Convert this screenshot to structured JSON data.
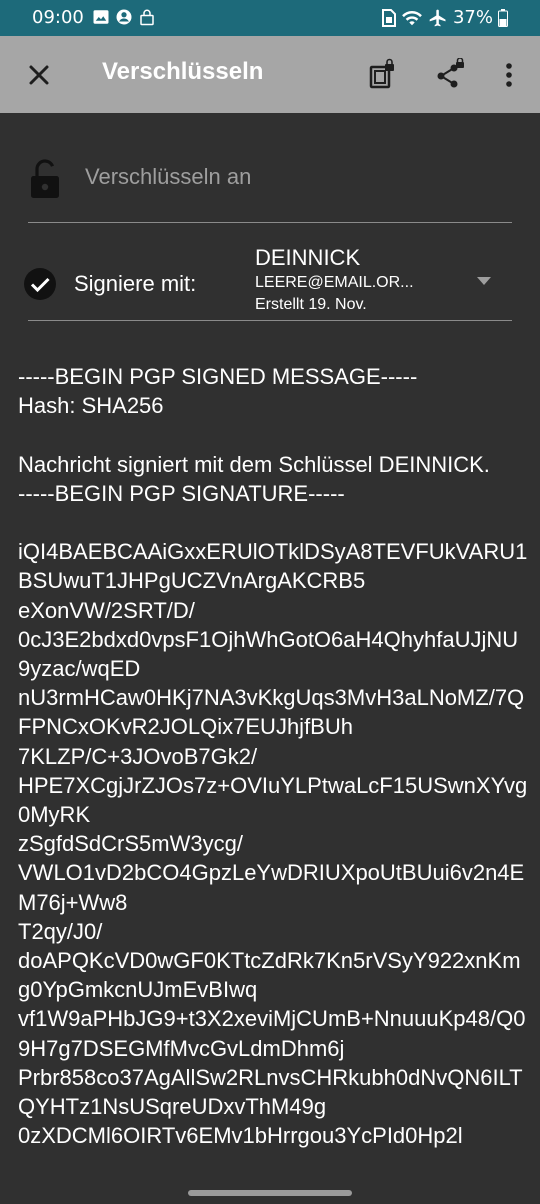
{
  "status_bar": {
    "time": "09:00",
    "battery": "37%",
    "left_icons": [
      "image-icon",
      "account-icon",
      "lock-icon"
    ],
    "right_icons": [
      "sim-icon",
      "wifi-icon",
      "airplane-icon",
      "battery-icon"
    ]
  },
  "toolbar": {
    "title": "Verschlüsseln",
    "actions": [
      "copy-to-clipboard-icon",
      "share-icon",
      "more-options-icon"
    ]
  },
  "encrypt": {
    "label": "Verschlüsseln an",
    "icon": "lock-open-icon"
  },
  "sign": {
    "label": "Signiere mit:",
    "key_name": "DEINNICK",
    "key_email": "LEERE@EMAIL.OR...",
    "key_created": "Erstellt 19. Nov.",
    "checked": true
  },
  "message": {
    "text": "-----BEGIN PGP SIGNED MESSAGE-----\nHash: SHA256\n\nNachricht signiert mit dem Schlüssel DEINNICK.\n-----BEGIN PGP SIGNATURE-----\n\niQI4BAEBCAAiGxxERUlOTklDSyA8TEVFUkVARU1BSUwuT1JHPgUCZVnArgAKCRB5\neXonVW/2SRT/D/\n0cJ3E2bdxd0vpsF1OjhWhGotO6aH4QhyhfaUJjNU9yzac/wqED\nnU3rmHCaw0HKj7NA3vKkgUqs3MvH3aLNoMZ/7QFPNCxOKvR2JOLQix7EUJhjfBUh\n7KLZP/C+3JOvoB7Gk2/\nHPE7XCgjJrZJOs7z+OVIuYLPtwaLcF15USwnXYvg0MyRK\nzSgfdSdCrS5mW3ycg/\nVWLO1vD2bCO4GpzLeYwDRIUXpoUtBUui6v2n4EM76j+Ww8\nT2qy/J0/\ndoAPQKcVD0wGF0KTtcZdRk7Kn5rVSyY922xnKmg0YpGmkcnUJmEvBIwq\nvf1W9aPHbJG9+t3X2xeviMjCUmB+NnuuuKp48/Q09H7g7DSEGMfMvcGvLdmDhm6j\nPrbr858co37AgAllSw2RLnvsCHRkubh0dNvQN6ILTQYHTz1NsUSqreUDxvThM49g\n0zXDCMl6OIRTv6EMv1bHrrgou3YcPId0Hp2l"
  },
  "colors": {
    "status_bar": "#1d6a7a",
    "toolbar": "#a6a6a6",
    "background": "#303030",
    "text": "#ffffff",
    "hint_text": "#9e9e9e",
    "divider": "#8a8a8a"
  }
}
